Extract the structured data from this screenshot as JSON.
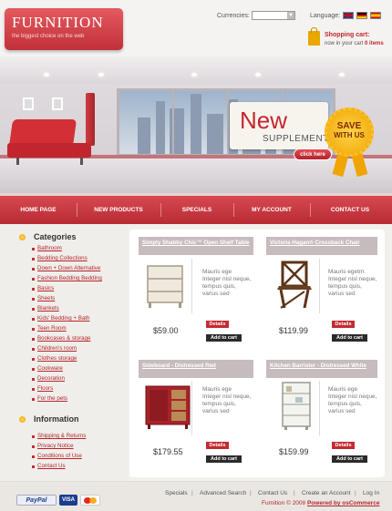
{
  "header": {
    "logo_title": "FURNITION",
    "logo_tagline": "the biggest choice on the web",
    "currencies_label": "Currencies:",
    "currency_value": "",
    "language_label": "Language:",
    "cart_title": "Shopping cart:",
    "cart_status_prefix": "now in your cart",
    "cart_count": "0",
    "cart_items_word": "items"
  },
  "banner": {
    "promo_title": "New",
    "promo_subtitle": "SUPPLEMENT",
    "click_button": "click here",
    "seal_line1": "SAVE",
    "seal_line2": "WITH US"
  },
  "nav": {
    "items": [
      "HOME PAGE",
      "NEW PRODUCTS",
      "SPECIALS",
      "MY ACCOUNT",
      "CONTACT US"
    ]
  },
  "sidebar": {
    "categories_title": "Categories",
    "categories": [
      "Bathroom",
      "Bedding Collections",
      "Down + Down Alternative",
      "Fashion Bedding Bedding",
      "Basics",
      "Sheets",
      "Blankets",
      "Kids' Bedding + Bath",
      "Teen Room",
      "Bookcases & storage",
      "Children's room",
      "Clothes storage",
      "Cookware",
      "Decoration",
      "Floors",
      "For the pets"
    ],
    "information_title": "Information",
    "information": [
      "Shipping & Returns",
      "Privacy Notice",
      "Conditions of Use",
      "Contact Us"
    ]
  },
  "products": [
    {
      "name": "Simply Shabby Chic™ Open Shelf Table",
      "description": "Mauris ege Integer nisl neque, tempus quis, varius sed",
      "price": "$59.00",
      "details": "Details",
      "add_to_cart": "Add to cart"
    },
    {
      "name": "Victoria Hagan® Crossback Chair",
      "description": "Mauris egetm. Integer nisl neque, tempus quis, varius sed",
      "price": "$119.99",
      "details": "Details",
      "add_to_cart": "Add to cart"
    },
    {
      "name": "Sideboard - Distressed Red",
      "description": "Mauris ege Integer nisl neque, tempus quis, varius sed",
      "price": "$179.55",
      "details": "Details",
      "add_to_cart": "Add to cart"
    },
    {
      "name": "Kitchen Barrister - Distressed White",
      "description": "Mauris ege Integer nisl neque, tempus quis, varius sed",
      "price": "$159.99",
      "details": "Details",
      "add_to_cart": "Add to cart"
    }
  ],
  "footer": {
    "links": [
      "Specials",
      "Advanced Search",
      "Contact Us",
      "Create an Account",
      "Log In"
    ],
    "paypal": "PayPal",
    "visa": "VISA",
    "copyright_prefix": "Furnition © 2008",
    "copyright_link": "Powered by osCommerce"
  },
  "colors": {
    "accent": "#c4262e",
    "nav": "#c93a41",
    "gold": "#f0a500"
  },
  "icons": [
    "shopping-bag-icon",
    "flag-en-icon",
    "flag-de-icon",
    "flag-es-icon",
    "category-dot-icon"
  ]
}
